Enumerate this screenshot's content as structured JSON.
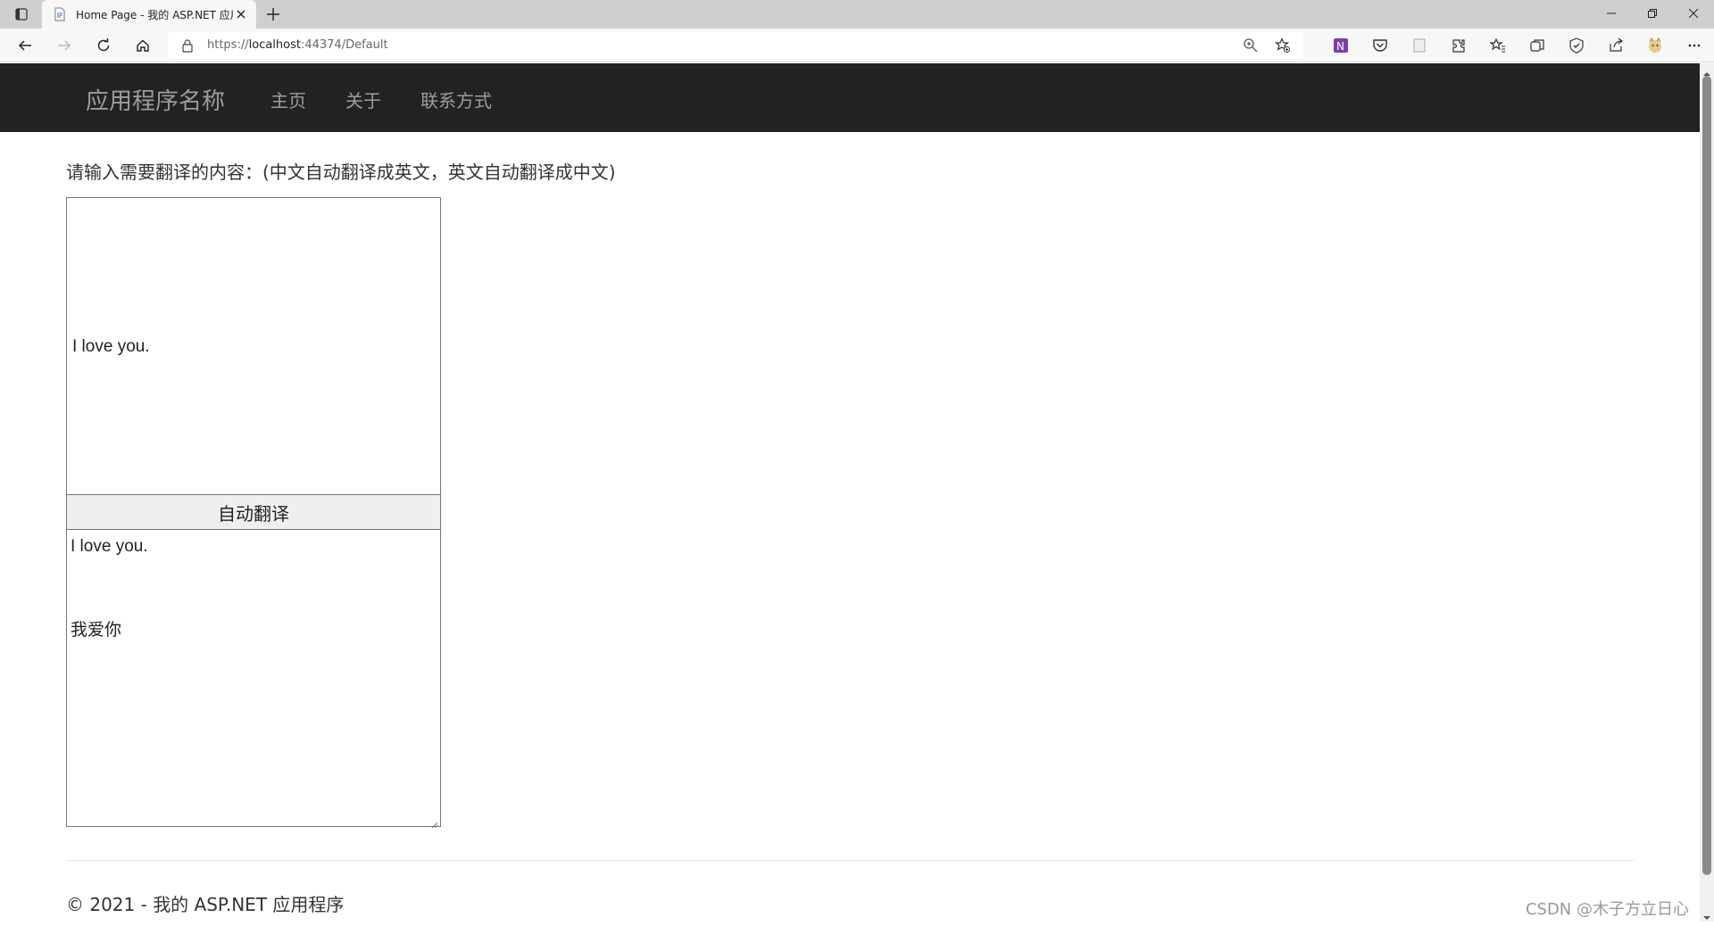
{
  "browser": {
    "tab_title": "Home Page - 我的 ASP.NET 应用",
    "url_scheme": "https://",
    "url_host": "localhost",
    "url_rest": ":44374/Default"
  },
  "nav": {
    "brand": "应用程序名称",
    "links": [
      "主页",
      "关于",
      "联系方式"
    ]
  },
  "main": {
    "prompt": "请输入需要翻译的内容：(中文自动翻译成英文，英文自动翻译成中文)",
    "input_value": "I love you.",
    "button_label": "自动翻译",
    "output_line1": "I love you.",
    "output_line2": "我爱你"
  },
  "footer": {
    "copyright": "© 2021 - 我的 ASP.NET 应用程序"
  },
  "watermark": "CSDN @木子方立日心",
  "icons": {
    "tab_actions": "tab-actions-icon",
    "favicon": "page-icon",
    "close": "close-icon",
    "new_tab": "plus-icon",
    "back": "back-arrow-icon",
    "forward": "forward-arrow-icon",
    "refresh": "refresh-icon",
    "home": "home-icon",
    "lock": "lock-icon",
    "zoom": "zoom-icon",
    "favorite": "add-favorite-icon"
  }
}
